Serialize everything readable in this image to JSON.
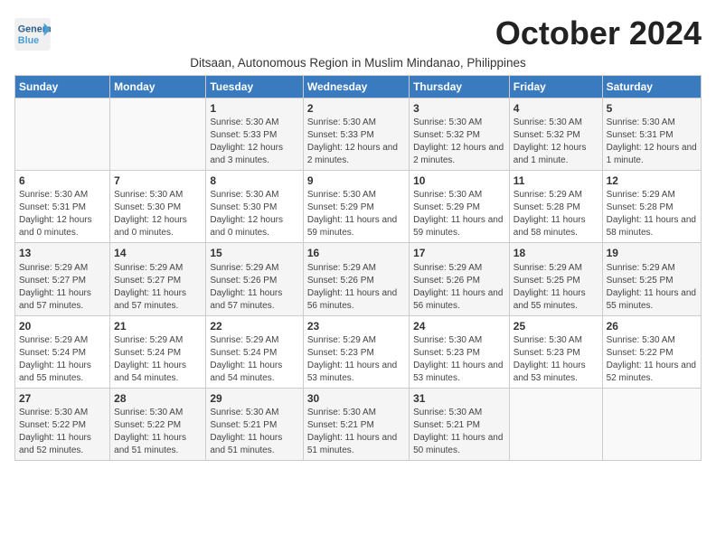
{
  "logo": {
    "general": "General",
    "blue": "Blue"
  },
  "title": "October 2024",
  "subtitle": "Ditsaan, Autonomous Region in Muslim Mindanao, Philippines",
  "headers": [
    "Sunday",
    "Monday",
    "Tuesday",
    "Wednesday",
    "Thursday",
    "Friday",
    "Saturday"
  ],
  "weeks": [
    [
      {
        "day": "",
        "sunrise": "",
        "sunset": "",
        "daylight": ""
      },
      {
        "day": "",
        "sunrise": "",
        "sunset": "",
        "daylight": ""
      },
      {
        "day": "1",
        "sunrise": "Sunrise: 5:30 AM",
        "sunset": "Sunset: 5:33 PM",
        "daylight": "Daylight: 12 hours and 3 minutes."
      },
      {
        "day": "2",
        "sunrise": "Sunrise: 5:30 AM",
        "sunset": "Sunset: 5:33 PM",
        "daylight": "Daylight: 12 hours and 2 minutes."
      },
      {
        "day": "3",
        "sunrise": "Sunrise: 5:30 AM",
        "sunset": "Sunset: 5:32 PM",
        "daylight": "Daylight: 12 hours and 2 minutes."
      },
      {
        "day": "4",
        "sunrise": "Sunrise: 5:30 AM",
        "sunset": "Sunset: 5:32 PM",
        "daylight": "Daylight: 12 hours and 1 minute."
      },
      {
        "day": "5",
        "sunrise": "Sunrise: 5:30 AM",
        "sunset": "Sunset: 5:31 PM",
        "daylight": "Daylight: 12 hours and 1 minute."
      }
    ],
    [
      {
        "day": "6",
        "sunrise": "Sunrise: 5:30 AM",
        "sunset": "Sunset: 5:31 PM",
        "daylight": "Daylight: 12 hours and 0 minutes."
      },
      {
        "day": "7",
        "sunrise": "Sunrise: 5:30 AM",
        "sunset": "Sunset: 5:30 PM",
        "daylight": "Daylight: 12 hours and 0 minutes."
      },
      {
        "day": "8",
        "sunrise": "Sunrise: 5:30 AM",
        "sunset": "Sunset: 5:30 PM",
        "daylight": "Daylight: 12 hours and 0 minutes."
      },
      {
        "day": "9",
        "sunrise": "Sunrise: 5:30 AM",
        "sunset": "Sunset: 5:29 PM",
        "daylight": "Daylight: 11 hours and 59 minutes."
      },
      {
        "day": "10",
        "sunrise": "Sunrise: 5:30 AM",
        "sunset": "Sunset: 5:29 PM",
        "daylight": "Daylight: 11 hours and 59 minutes."
      },
      {
        "day": "11",
        "sunrise": "Sunrise: 5:29 AM",
        "sunset": "Sunset: 5:28 PM",
        "daylight": "Daylight: 11 hours and 58 minutes."
      },
      {
        "day": "12",
        "sunrise": "Sunrise: 5:29 AM",
        "sunset": "Sunset: 5:28 PM",
        "daylight": "Daylight: 11 hours and 58 minutes."
      }
    ],
    [
      {
        "day": "13",
        "sunrise": "Sunrise: 5:29 AM",
        "sunset": "Sunset: 5:27 PM",
        "daylight": "Daylight: 11 hours and 57 minutes."
      },
      {
        "day": "14",
        "sunrise": "Sunrise: 5:29 AM",
        "sunset": "Sunset: 5:27 PM",
        "daylight": "Daylight: 11 hours and 57 minutes."
      },
      {
        "day": "15",
        "sunrise": "Sunrise: 5:29 AM",
        "sunset": "Sunset: 5:26 PM",
        "daylight": "Daylight: 11 hours and 57 minutes."
      },
      {
        "day": "16",
        "sunrise": "Sunrise: 5:29 AM",
        "sunset": "Sunset: 5:26 PM",
        "daylight": "Daylight: 11 hours and 56 minutes."
      },
      {
        "day": "17",
        "sunrise": "Sunrise: 5:29 AM",
        "sunset": "Sunset: 5:26 PM",
        "daylight": "Daylight: 11 hours and 56 minutes."
      },
      {
        "day": "18",
        "sunrise": "Sunrise: 5:29 AM",
        "sunset": "Sunset: 5:25 PM",
        "daylight": "Daylight: 11 hours and 55 minutes."
      },
      {
        "day": "19",
        "sunrise": "Sunrise: 5:29 AM",
        "sunset": "Sunset: 5:25 PM",
        "daylight": "Daylight: 11 hours and 55 minutes."
      }
    ],
    [
      {
        "day": "20",
        "sunrise": "Sunrise: 5:29 AM",
        "sunset": "Sunset: 5:24 PM",
        "daylight": "Daylight: 11 hours and 55 minutes."
      },
      {
        "day": "21",
        "sunrise": "Sunrise: 5:29 AM",
        "sunset": "Sunset: 5:24 PM",
        "daylight": "Daylight: 11 hours and 54 minutes."
      },
      {
        "day": "22",
        "sunrise": "Sunrise: 5:29 AM",
        "sunset": "Sunset: 5:24 PM",
        "daylight": "Daylight: 11 hours and 54 minutes."
      },
      {
        "day": "23",
        "sunrise": "Sunrise: 5:29 AM",
        "sunset": "Sunset: 5:23 PM",
        "daylight": "Daylight: 11 hours and 53 minutes."
      },
      {
        "day": "24",
        "sunrise": "Sunrise: 5:30 AM",
        "sunset": "Sunset: 5:23 PM",
        "daylight": "Daylight: 11 hours and 53 minutes."
      },
      {
        "day": "25",
        "sunrise": "Sunrise: 5:30 AM",
        "sunset": "Sunset: 5:23 PM",
        "daylight": "Daylight: 11 hours and 53 minutes."
      },
      {
        "day": "26",
        "sunrise": "Sunrise: 5:30 AM",
        "sunset": "Sunset: 5:22 PM",
        "daylight": "Daylight: 11 hours and 52 minutes."
      }
    ],
    [
      {
        "day": "27",
        "sunrise": "Sunrise: 5:30 AM",
        "sunset": "Sunset: 5:22 PM",
        "daylight": "Daylight: 11 hours and 52 minutes."
      },
      {
        "day": "28",
        "sunrise": "Sunrise: 5:30 AM",
        "sunset": "Sunset: 5:22 PM",
        "daylight": "Daylight: 11 hours and 51 minutes."
      },
      {
        "day": "29",
        "sunrise": "Sunrise: 5:30 AM",
        "sunset": "Sunset: 5:21 PM",
        "daylight": "Daylight: 11 hours and 51 minutes."
      },
      {
        "day": "30",
        "sunrise": "Sunrise: 5:30 AM",
        "sunset": "Sunset: 5:21 PM",
        "daylight": "Daylight: 11 hours and 51 minutes."
      },
      {
        "day": "31",
        "sunrise": "Sunrise: 5:30 AM",
        "sunset": "Sunset: 5:21 PM",
        "daylight": "Daylight: 11 hours and 50 minutes."
      },
      {
        "day": "",
        "sunrise": "",
        "sunset": "",
        "daylight": ""
      },
      {
        "day": "",
        "sunrise": "",
        "sunset": "",
        "daylight": ""
      }
    ]
  ]
}
